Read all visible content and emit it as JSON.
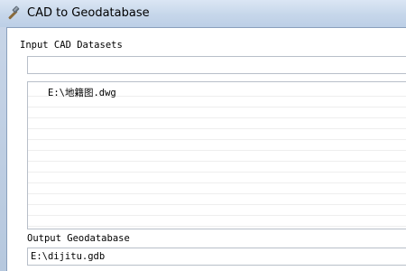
{
  "window": {
    "title": "CAD to Geodatabase",
    "icon": "hammer-icon"
  },
  "input": {
    "label": "Input CAD Datasets",
    "value": "",
    "datasets": [
      "E:\\地籍图.dwg"
    ]
  },
  "output": {
    "label": "Output Geodatabase",
    "value": "E:\\dijitu.gdb"
  }
}
